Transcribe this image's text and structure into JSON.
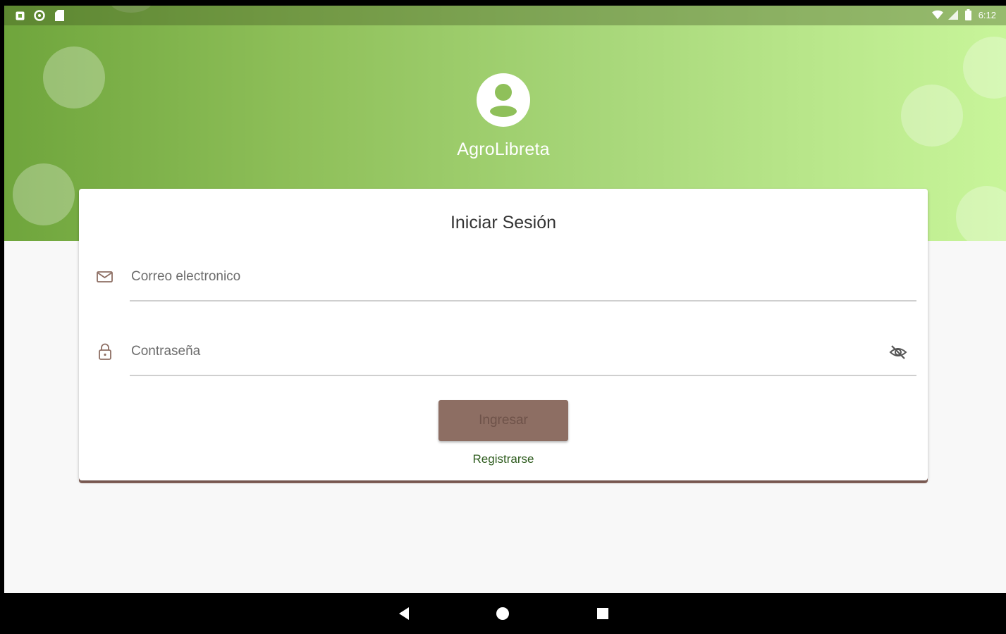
{
  "status_bar": {
    "time": "6:12",
    "left_icons": [
      "notification-icon",
      "sync-icon",
      "sd-card-icon"
    ],
    "right_icons": [
      "wifi-icon",
      "signal-icon",
      "battery-icon"
    ]
  },
  "app": {
    "name": "AgroLibreta",
    "avatar_icon": "account-circle-icon"
  },
  "login": {
    "title": "Iniciar Sesión",
    "email": {
      "placeholder": "Correo electronico",
      "value": "",
      "icon": "mail-icon"
    },
    "password": {
      "placeholder": "Contraseña",
      "value": "",
      "icon": "lock-icon",
      "toggle_icon": "eye-off-icon"
    },
    "submit_label": "Ingresar",
    "register_label": "Registrarse"
  },
  "colors": {
    "header_start": "#6fa53c",
    "header_end": "#c8f59a",
    "button": "#8d6e63",
    "button_text": "#6e5249",
    "link": "#2e5c1e",
    "card_accent": "#8a675e"
  },
  "nav_bar": {
    "buttons": [
      "back-icon",
      "home-icon",
      "recents-icon"
    ]
  }
}
